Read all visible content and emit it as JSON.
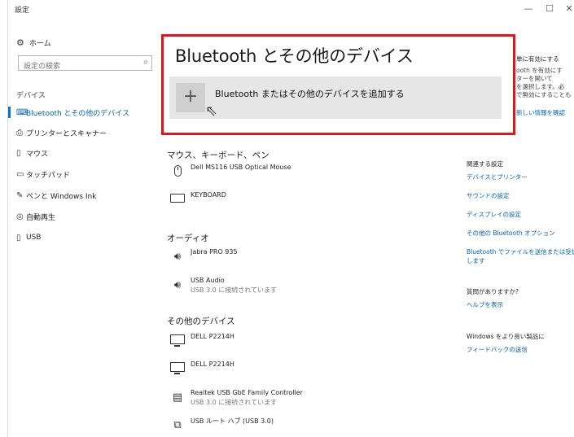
{
  "window": {
    "title": "設定",
    "minimize": "—",
    "maximize": "☐",
    "close": "✕"
  },
  "sidebar": {
    "home_label": "ホーム",
    "search_placeholder": "設定の検索",
    "section_label": "デバイス",
    "items": [
      {
        "label": "Bluetooth とその他のデバイス",
        "icon": "bluetooth-device-icon",
        "active": true
      },
      {
        "label": "プリンターとスキャナー",
        "icon": "printer-icon",
        "active": false
      },
      {
        "label": "マウス",
        "icon": "mouse-icon",
        "active": false
      },
      {
        "label": "タッチパッド",
        "icon": "touchpad-icon",
        "active": false
      },
      {
        "label": "ペンと Windows Ink",
        "icon": "pen-icon",
        "active": false
      },
      {
        "label": "自動再生",
        "icon": "autoplay-icon",
        "active": false
      },
      {
        "label": "USB",
        "icon": "usb-icon",
        "active": false
      }
    ]
  },
  "main": {
    "title": "Bluetooth とその他のデバイス",
    "add_device_label": "Bluetooth またはその他のデバイスを追加する",
    "add_device_symbol": "+",
    "categories": [
      {
        "heading": "マウス、キーボード、ペン",
        "devices": [
          {
            "name": "Dell MS116 USB Optical Mouse",
            "status": "",
            "icon": "mouse-icon"
          },
          {
            "name": "KEYBOARD",
            "status": "",
            "icon": "keyboard-icon"
          }
        ]
      },
      {
        "heading": "オーディオ",
        "devices": [
          {
            "name": "Jabra PRO 935",
            "status": "",
            "icon": "speaker-icon"
          },
          {
            "name": "USB Audio",
            "status": "USB 3.0 に接続されています",
            "icon": "speaker-icon"
          }
        ]
      },
      {
        "heading": "その他のデバイス",
        "devices": [
          {
            "name": "DELL P2214H",
            "status": "",
            "icon": "monitor-icon"
          },
          {
            "name": "DELL P2214H",
            "status": "",
            "icon": "monitor-icon"
          },
          {
            "name": "Realtek USB GbE Family Controller",
            "status": "USB 3.0 に接続されています",
            "icon": "network-adapter-icon"
          },
          {
            "name": "USB ルート ハブ (USB 3.0)",
            "status": "",
            "icon": "usb-hub-icon"
          }
        ]
      }
    ]
  },
  "right": {
    "partial_lines": [
      "単に有効にする",
      "ooth を有効にす",
      "ターを開いて",
      "を選択します。必",
      "で無効にすることも"
    ],
    "partial_link": "新しい情報を確認",
    "related_heading": "関連する設定",
    "related_links": [
      "デバイスとプリンター",
      "サウンドの設定",
      "ディスプレイの設定",
      "その他の Bluetooth オプション",
      "Bluetooth でファイルを送信または受信",
      "します"
    ],
    "question_heading": "質問がありますか?",
    "help_link": "ヘルプを表示",
    "improve_heading": "Windows をより良い製品に",
    "feedback_link": "フィードバックの送信"
  },
  "colors": {
    "accent": "#0078d7",
    "link": "#0063b1",
    "highlight": "#e0171f",
    "add_bg": "#e6e6e6"
  }
}
